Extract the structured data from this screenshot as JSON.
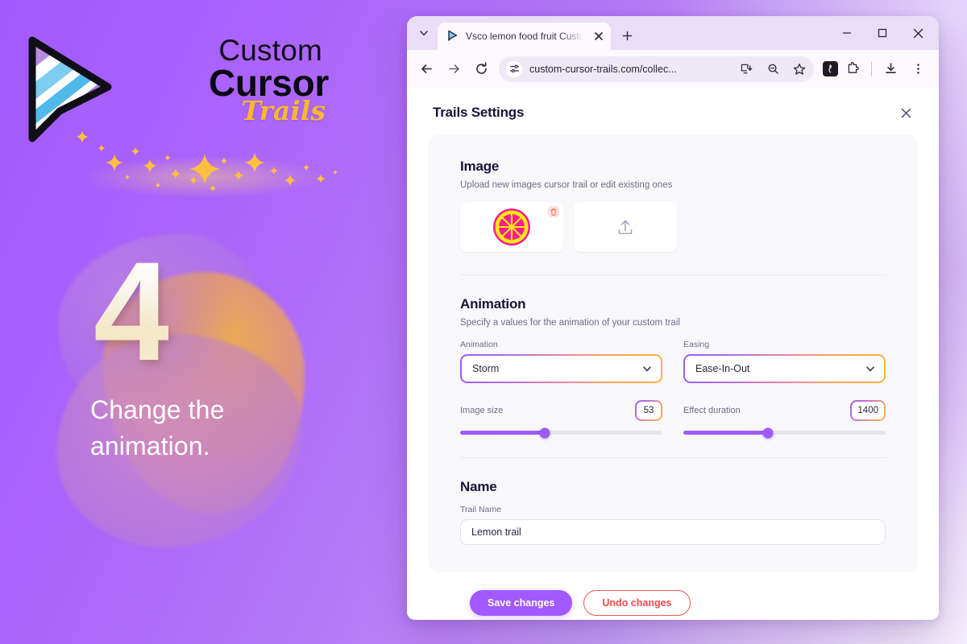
{
  "promo": {
    "logo": {
      "line1": "Custom",
      "line2": "Cursor",
      "line3": "Trails"
    },
    "step_number": "4",
    "caption": "Change the animation."
  },
  "browser": {
    "tab": {
      "title": "Vsco lemon food fruit Custom C",
      "favicon_name": "cursor-favicon",
      "close_label": "✕",
      "new_tab_label": "+"
    },
    "window_controls": {
      "minimize": "─",
      "maximize": "□",
      "close": "✕"
    },
    "toolbar": {
      "back": "←",
      "forward": "→",
      "reload": "↻",
      "url": "custom-cursor-trails.com/collec...",
      "icons": [
        "install-app-icon",
        "zoom-out-icon",
        "bookmark-star-icon",
        "extension-badge-icon",
        "extensions-puzzle-icon",
        "downloads-icon",
        "browser-menu-icon"
      ]
    }
  },
  "modal": {
    "title": "Trails Settings",
    "close_label": "✕",
    "image_section": {
      "title": "Image",
      "subtitle": "Upload new images cursor trail or edit existing ones",
      "thumbnails": [
        {
          "name": "lemon-slice-thumbnail",
          "has_delete": true
        },
        {
          "name": "upload-new-image-tile",
          "has_delete": false
        }
      ]
    },
    "animation_section": {
      "title": "Animation",
      "subtitle": "Specify a values for the animation of your custom trail",
      "animation_field": {
        "label": "Animation",
        "value": "Storm"
      },
      "easing_field": {
        "label": "Easing",
        "value": "Ease-In-Out"
      },
      "image_size": {
        "label": "Image size",
        "value": "53",
        "percent": 42
      },
      "effect_duration": {
        "label": "Effect duration",
        "value": "1400",
        "percent": 42
      }
    },
    "name_section": {
      "title": "Name",
      "field_label": "Trail Name",
      "value": "Lemon trail"
    },
    "actions": {
      "save_label": "Save changes",
      "undo_label": "Undo changes"
    }
  },
  "colors": {
    "accent_purple": "#a259ff",
    "accent_gold": "#f7b733",
    "danger_red": "#ef5b50",
    "gradient_start": "#9b5cf6",
    "gradient_end": "#f5b43e"
  }
}
